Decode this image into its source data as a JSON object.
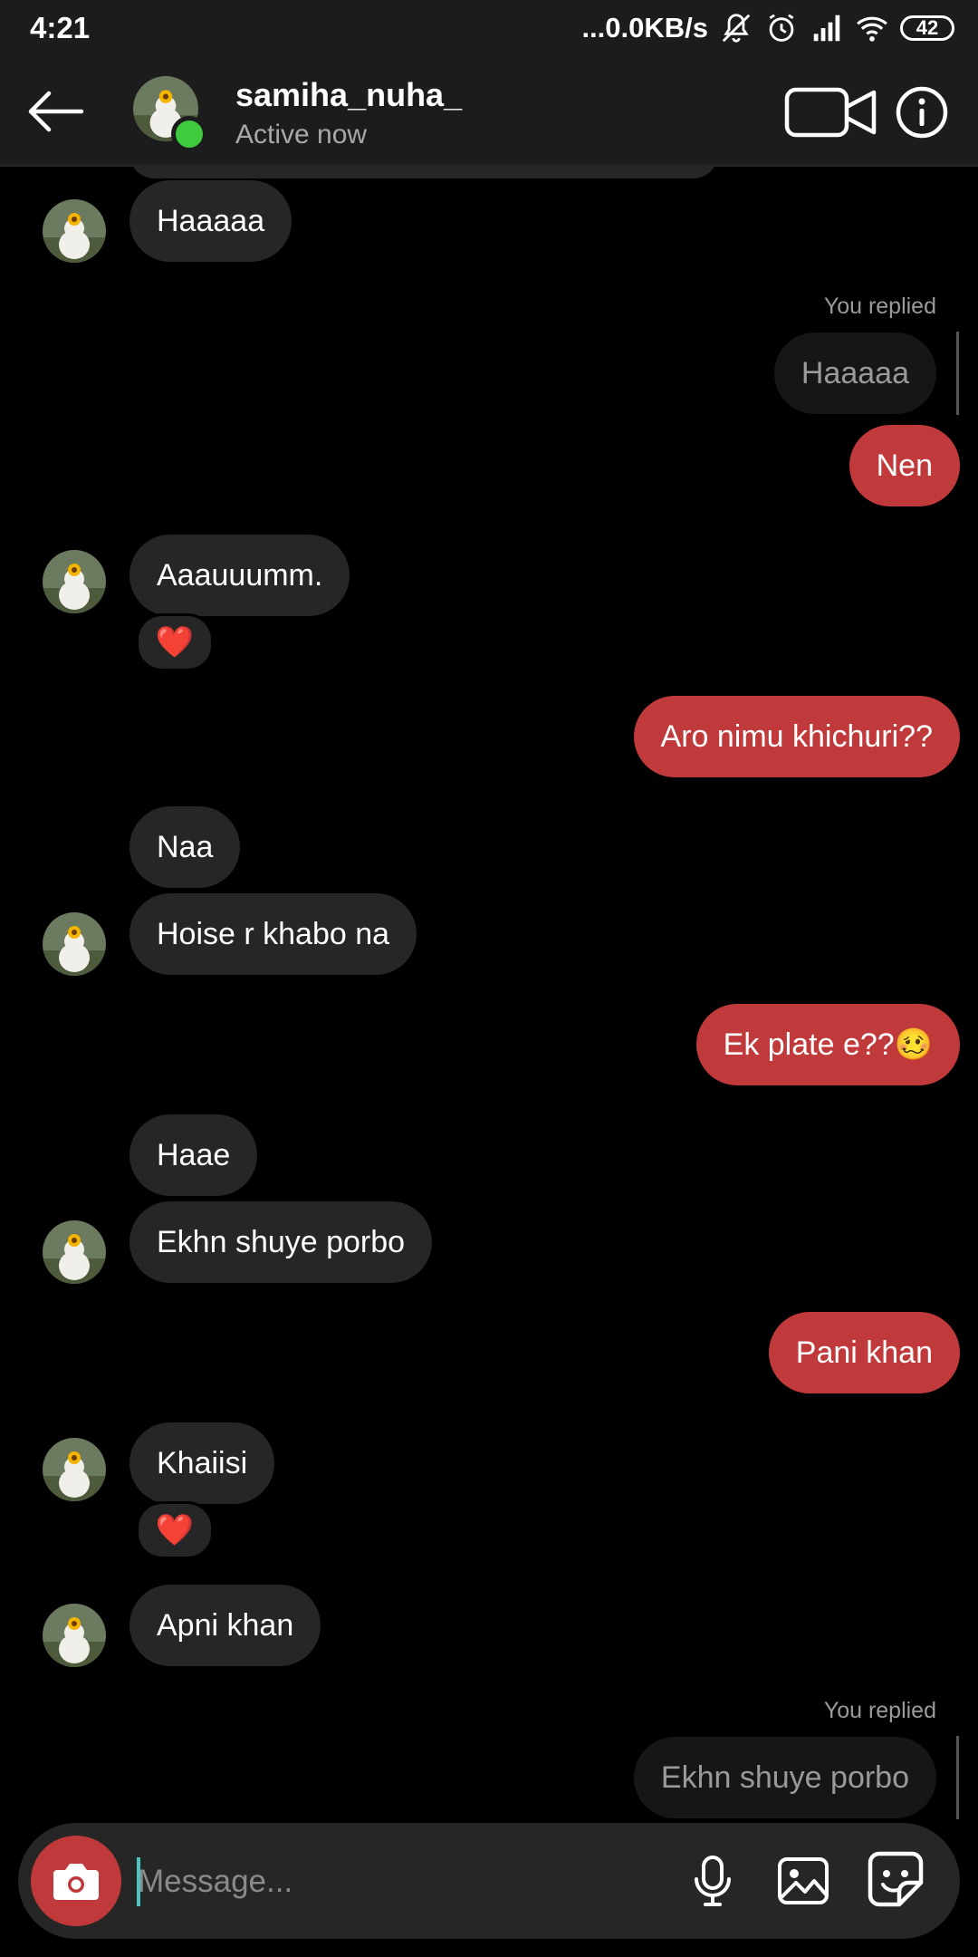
{
  "status_bar": {
    "time": "4:21",
    "network_speed": "...0.0KB/s",
    "battery": "42",
    "icons": [
      "mute-bell-icon",
      "alarm-icon",
      "signal-icon",
      "wifi-icon",
      "battery-icon"
    ]
  },
  "header": {
    "username": "samiha_nuha_",
    "status": "Active now",
    "icons": [
      "back-arrow-icon",
      "video-call-icon",
      "info-icon"
    ],
    "online_color": "#3ecb3e"
  },
  "messages": [
    {
      "side": "in",
      "text": "Haaaaa"
    },
    {
      "side": "out",
      "reply_label": "You replied",
      "replied_to": "Haaaaa",
      "text": "Nen"
    },
    {
      "side": "in",
      "text": "Aaauuumm.",
      "reaction": "❤️"
    },
    {
      "side": "out",
      "text": "Aro nimu khichuri??"
    },
    {
      "side": "in",
      "text": "Naa"
    },
    {
      "side": "in",
      "text": "Hoise r khabo na"
    },
    {
      "side": "out",
      "text": "Ek plate e??🥴"
    },
    {
      "side": "in",
      "text": "Haae"
    },
    {
      "side": "in",
      "text": "Ekhn shuye porbo"
    },
    {
      "side": "out",
      "text": "Pani khan"
    },
    {
      "side": "in",
      "text": "Khaiisi",
      "reaction": "❤️"
    },
    {
      "side": "in",
      "text": "Apni khan"
    },
    {
      "side": "out",
      "reply_label": "You replied",
      "replied_to": "Ekhn shuye porbo"
    }
  ],
  "composer": {
    "placeholder": "Message...",
    "icons": [
      "camera-icon",
      "microphone-icon",
      "gallery-icon",
      "sticker-icon"
    ]
  },
  "colors": {
    "outgoing_bubble": "#c0393b",
    "incoming_bubble": "#262626",
    "background": "#000000",
    "bar_background": "#1c1c1c"
  }
}
